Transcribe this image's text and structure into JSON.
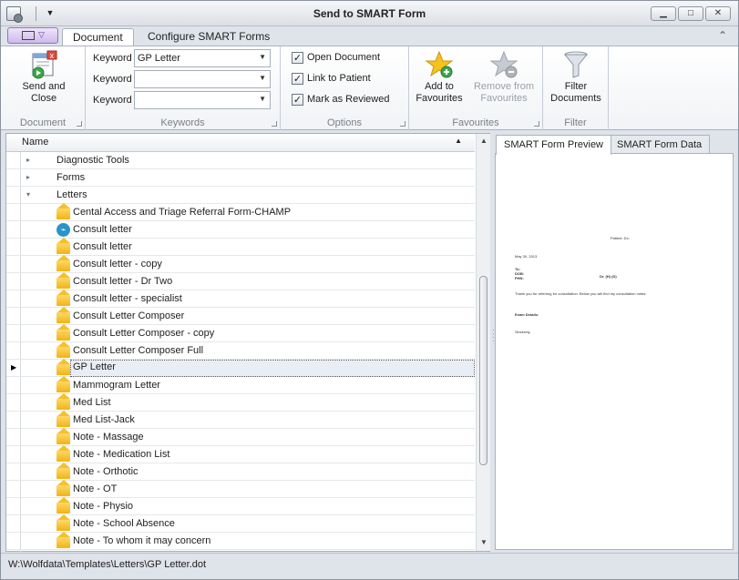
{
  "window": {
    "title": "Send to SMART Form"
  },
  "ribbon": {
    "tabs": [
      {
        "label": "Document"
      },
      {
        "label": "Configure SMART Forms"
      }
    ],
    "document_group": {
      "send_close": "Send and\nClose",
      "label": "Document"
    },
    "keywords_group": {
      "label": "Keywords",
      "rows": [
        {
          "label": "Keyword",
          "value": "GP Letter"
        },
        {
          "label": "Keyword",
          "value": ""
        },
        {
          "label": "Keyword",
          "value": ""
        }
      ]
    },
    "options_group": {
      "label": "Options",
      "open_document": "Open Document",
      "link_patient": "Link to Patient",
      "mark_reviewed": "Mark as Reviewed"
    },
    "favourites_group": {
      "label": "Favourites",
      "add": "Add to\nFavourites",
      "remove": "Remove from\nFavourites"
    },
    "filter_group": {
      "label": "Filter",
      "filter": "Filter\nDocuments"
    }
  },
  "grid": {
    "header": "Name",
    "folders": [
      "Diagnostic Tools",
      "Forms",
      "Letters"
    ],
    "items": [
      "Cental Access and Triage Referral Form-CHAMP",
      "Consult letter",
      "Consult letter",
      "Consult letter - copy",
      "Consult letter - Dr Two",
      "Consult letter - specialist",
      "Consult Letter Composer",
      "Consult Letter Composer - copy",
      "Consult Letter Composer Full",
      "GP Letter",
      "Mammogram Letter",
      "Med List",
      "Med List-Jack",
      "Note - Massage",
      "Note - Medication List",
      "Note - Orthotic",
      "Note - OT",
      "Note - Physio",
      "Note - School Absence",
      "Note - To whom it may concern"
    ],
    "selected_item": "GP Letter"
  },
  "preview": {
    "tabs": [
      {
        "label": "SMART Form Preview"
      },
      {
        "label": "SMART Form Data"
      }
    ],
    "doc": {
      "header_line": "Patient:   Dx:",
      "date": "May 30, 2013",
      "to_label": "To:",
      "to_dob": "DOB:",
      "to_phn": "PHN:",
      "right_line": "Dr. (H) (D)",
      "body": "Thank you for referring  for consultation. Below you will find my consultation notes:",
      "exam": "Exam Details:",
      "sign": "Sincerely,"
    }
  },
  "status": {
    "path": "W:\\Wolfdata\\Templates\\Letters\\GP Letter.dot"
  }
}
